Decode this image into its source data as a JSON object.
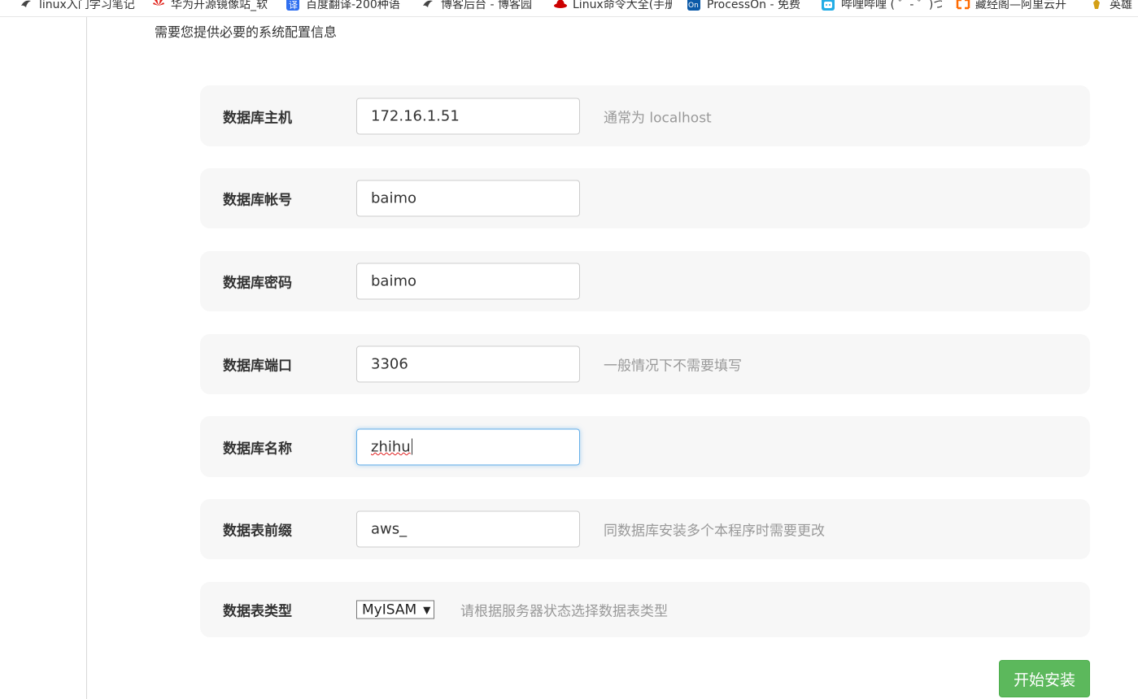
{
  "bookmarks": [
    {
      "label": "linux入门学习笔记",
      "icon": "bird-logo-icon"
    },
    {
      "label": "华为开源镜像站_软",
      "icon": "huawei-logo-icon"
    },
    {
      "label": "百度翻译-200种语",
      "icon": "translate-icon"
    },
    {
      "label": "博客后台 - 博客园",
      "icon": "bird-logo-icon"
    },
    {
      "label": "Linux命令大全(手册",
      "icon": "redhat-logo-icon"
    },
    {
      "label": "ProcessOn - 免费",
      "icon": "processon-logo-icon"
    },
    {
      "label": "哔哩哔哩 ( ゜- ゜)つ",
      "icon": "bilibili-logo-icon"
    },
    {
      "label": "藏经阁—阿里云开",
      "icon": "aliyun-logo-icon"
    },
    {
      "label": "英雄",
      "icon": "hero-icon"
    }
  ],
  "intro_text": "需要您提供必要的系统配置信息",
  "fields": {
    "db_host": {
      "label": "数据库主机",
      "value": "172.16.1.51",
      "hint": "通常为 localhost"
    },
    "db_user": {
      "label": "数据库帐号",
      "value": "baimo"
    },
    "db_pass": {
      "label": "数据库密码",
      "value": "baimo"
    },
    "db_port": {
      "label": "数据库端口",
      "value": "3306",
      "hint": "一般情况下不需要填写"
    },
    "db_name": {
      "label": "数据库名称",
      "value": "zhihu"
    },
    "db_prefix": {
      "label": "数据表前缀",
      "value": "aws_",
      "hint": "同数据库安装多个本程序时需要更改"
    },
    "db_engine": {
      "label": "数据表类型",
      "value": "MyISAM",
      "hint": "请根据服务器状态选择数据表类型"
    }
  },
  "install_button": "开始安装",
  "colors": {
    "primary_green": "#5cb85c",
    "row_background": "#f7f7f7",
    "hint_gray": "#999999",
    "focus_blue": "#66afe9"
  }
}
